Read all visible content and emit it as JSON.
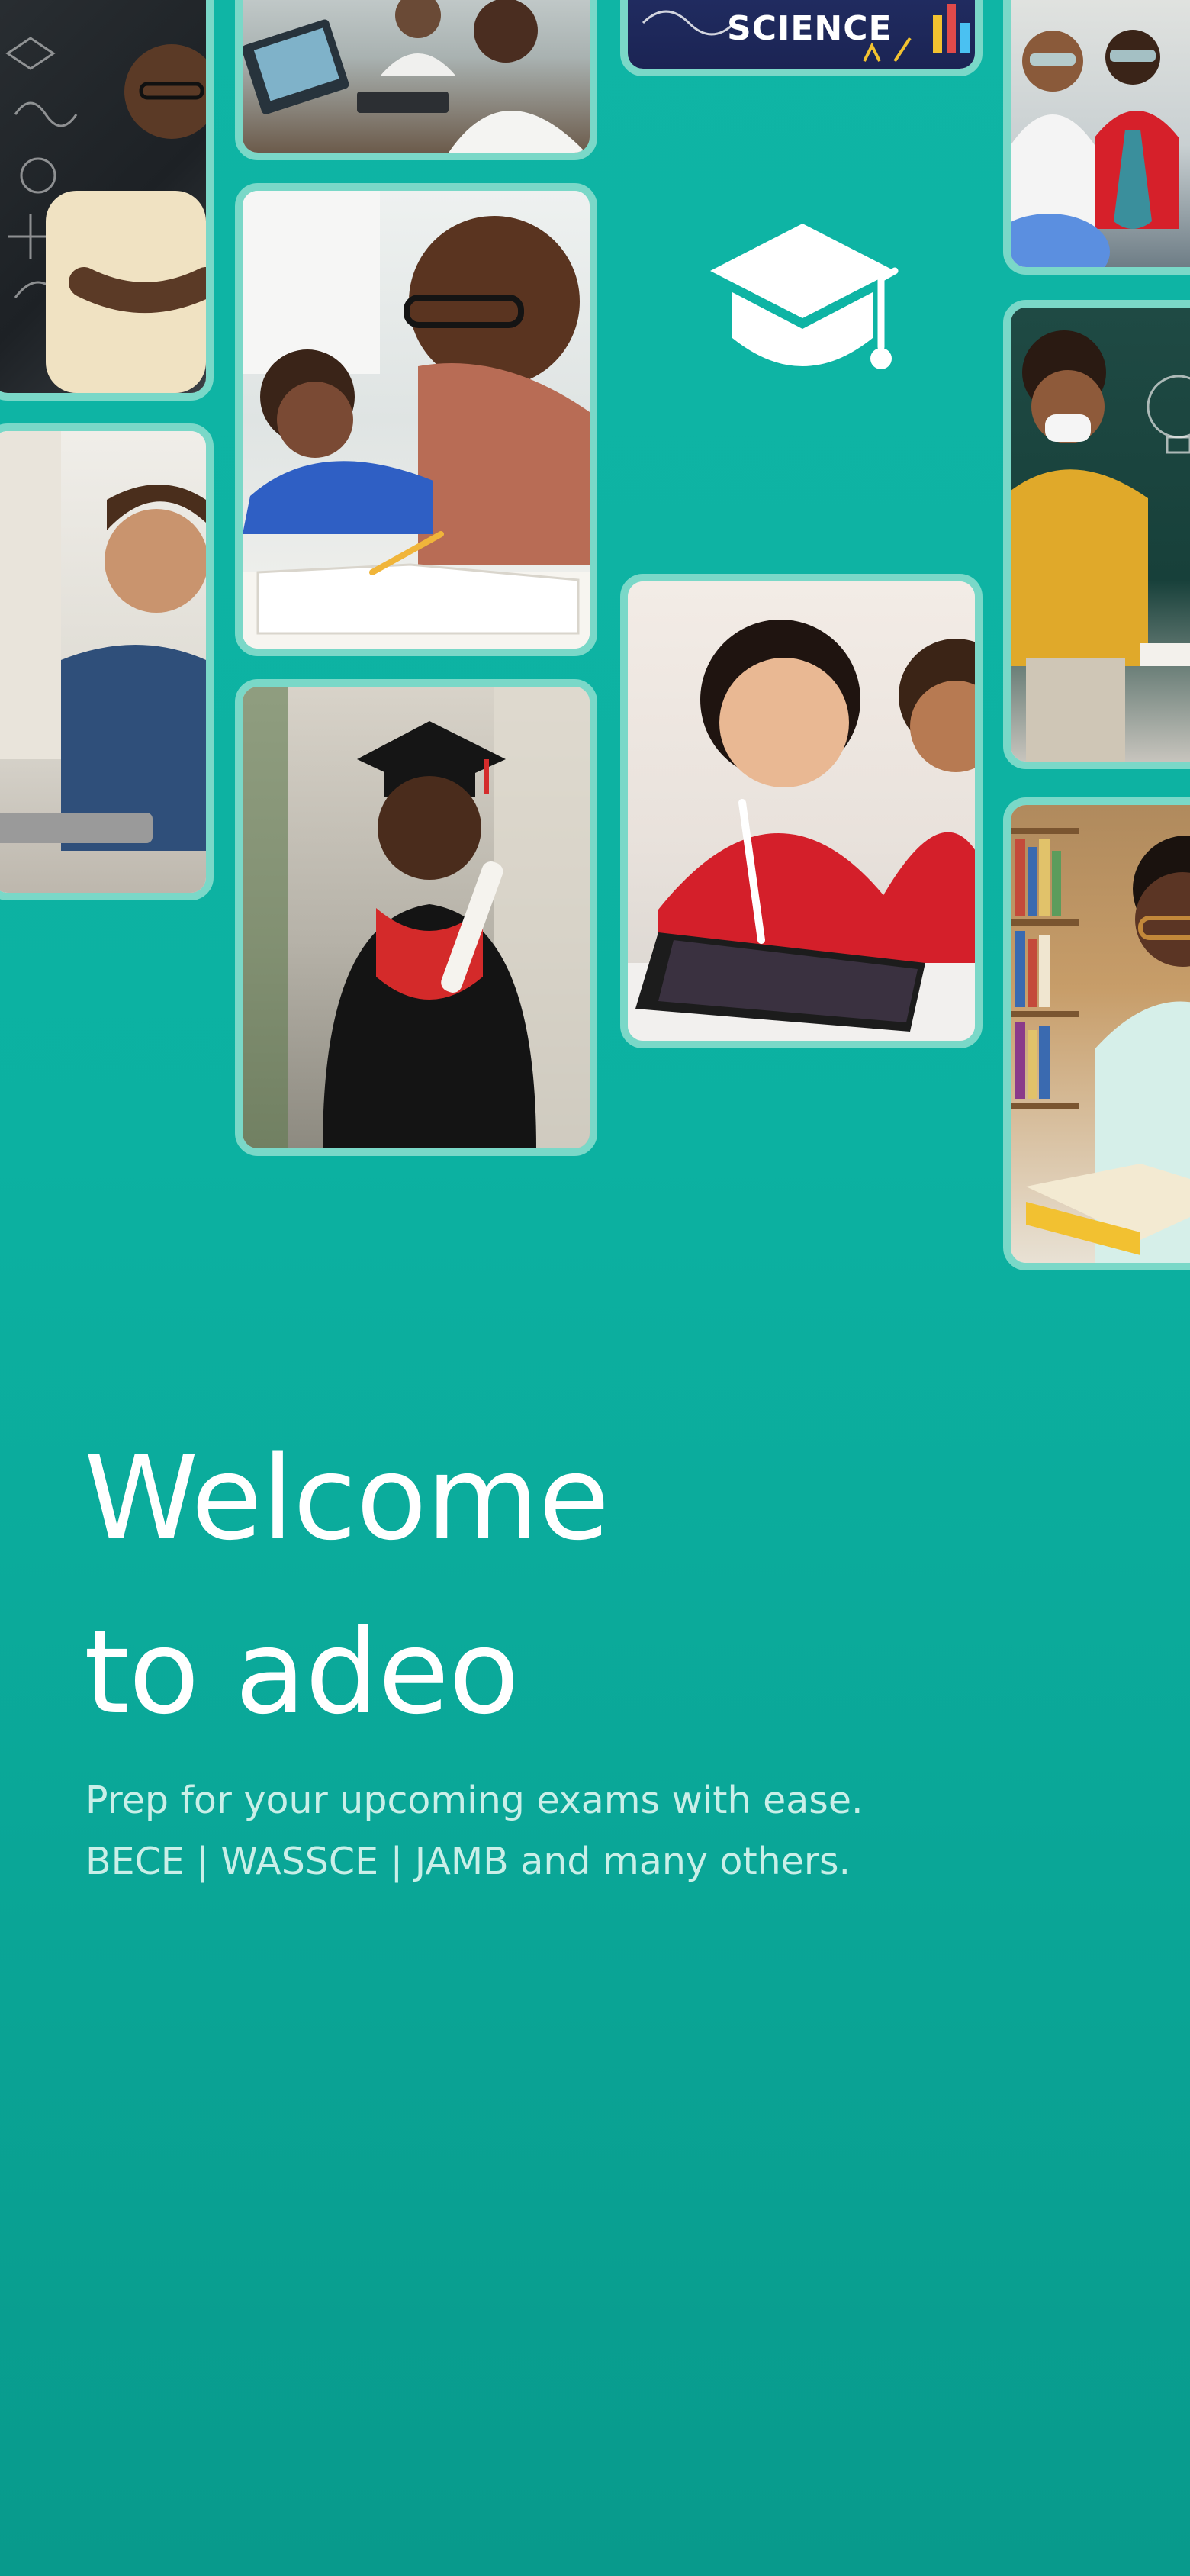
{
  "colors": {
    "background_top": "#0fb5a5",
    "background_bottom": "#089a8c",
    "card_border": "#7ad8c8",
    "heading": "#ffffff",
    "subtitle": "#c9efe8"
  },
  "icons": {
    "app_logo": "graduation-cap-icon"
  },
  "collage": {
    "photos": [
      {
        "name": "teacher-at-chalkboard"
      },
      {
        "name": "boy-with-laptop"
      },
      {
        "name": "students-at-computers"
      },
      {
        "name": "teacher-helping-student"
      },
      {
        "name": "graduate-with-diploma"
      },
      {
        "name": "science-chalkboard"
      },
      {
        "name": "kids-with-tablet"
      },
      {
        "name": "students-in-lab"
      },
      {
        "name": "teacher-at-board"
      },
      {
        "name": "student-reading-in-library"
      }
    ],
    "science_board_text": "SCIENCE"
  },
  "welcome": {
    "line1": "Welcome",
    "line2": "to adeo",
    "subtitle_line1": "Prep for your upcoming exams with ease.",
    "subtitle_line2": "BECE | WASSCE | JAMB and many others."
  }
}
